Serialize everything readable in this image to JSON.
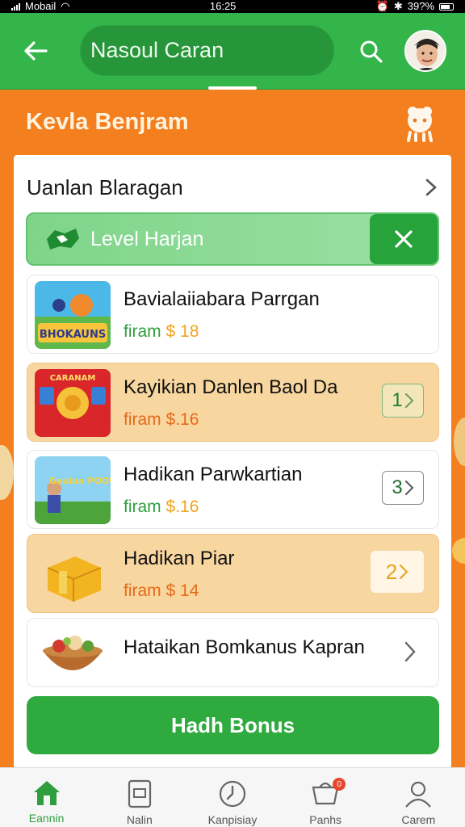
{
  "status_bar": {
    "carrier": "Mobail",
    "time": "16:25",
    "battery": "39?%"
  },
  "header": {
    "search_value": "Nasoul Caran",
    "active_tab_indicator": true
  },
  "banner": {
    "title": "Kevla Benjram"
  },
  "card": {
    "header_title": "Uanlan Blaragan",
    "level_bar": {
      "label": "Level Harjan"
    },
    "items": [
      {
        "name": "Bavialaiiabara Parrgan",
        "price_label": "firam",
        "price_value": "$ 18",
        "thumb_text": "BHOKAUNS",
        "highlight": false
      },
      {
        "name": "Kayikian Danlen Baol Da",
        "price_label": "firam",
        "price_value": "$.16",
        "thumb_text": "CARANAM",
        "badge": "1",
        "highlight": true
      },
      {
        "name": "Hadikan Parwkartian",
        "price_label": "firam",
        "price_value": "$.16",
        "thumb_text": "Gaulun PODUN",
        "badge": "3",
        "highlight": false
      },
      {
        "name": "Hadikan Piar",
        "price_label": "firam",
        "price_value": "$ 14",
        "badge": "2",
        "highlight": true
      },
      {
        "name": "Hataikan Bomkanus Kapran",
        "highlight": false
      }
    ],
    "bonus_button": "Hadh Bonus"
  },
  "bottom_nav": {
    "items": [
      {
        "label": "Eannin",
        "icon": "home-icon",
        "active": true
      },
      {
        "label": "Nalin",
        "icon": "phone-icon",
        "active": false
      },
      {
        "label": "Kanpisiay",
        "icon": "clock-icon",
        "active": false
      },
      {
        "label": "Panhs",
        "icon": "basket-icon",
        "active": false,
        "badge": "0"
      },
      {
        "label": "Carem",
        "icon": "profile-icon",
        "active": false
      }
    ]
  },
  "colors": {
    "brand_green": "#33b54a",
    "brand_orange": "#f47f1e",
    "highlight_row": "#f8d69f"
  }
}
